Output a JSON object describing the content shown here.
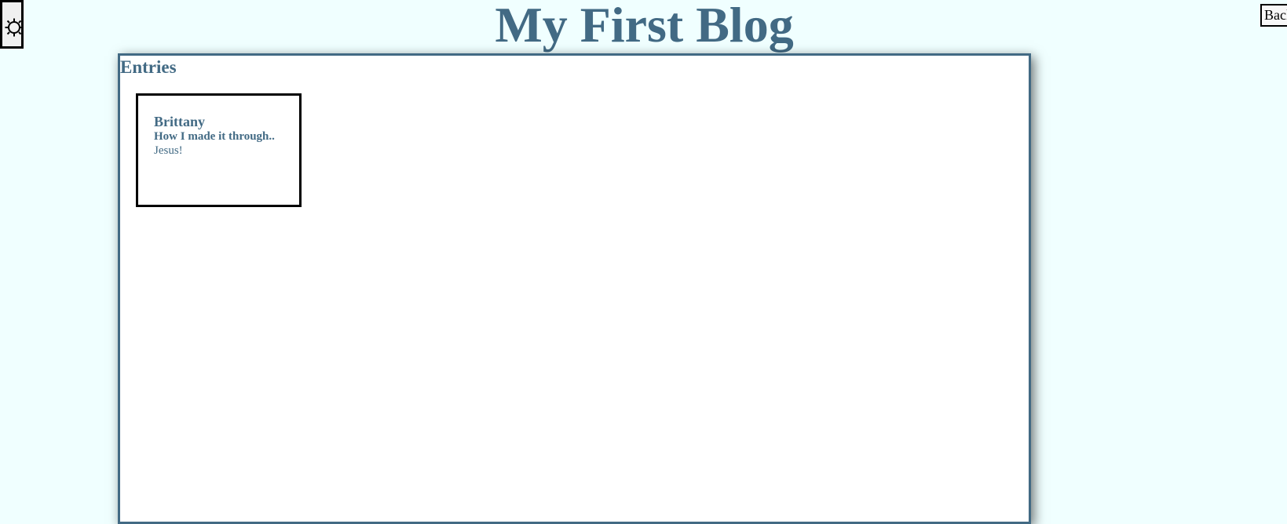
{
  "header": {
    "title": "My First Blog",
    "theme_toggle_icon": "sun-icon",
    "back_label": "Back"
  },
  "entries": {
    "heading": "Entries",
    "items": [
      {
        "author": "Brittany",
        "title": "How I made it through..",
        "body": "Jesus!"
      }
    ]
  },
  "colors": {
    "page_background": "#f0ffff",
    "accent": "#426a84",
    "panel_background": "#ffffff"
  }
}
